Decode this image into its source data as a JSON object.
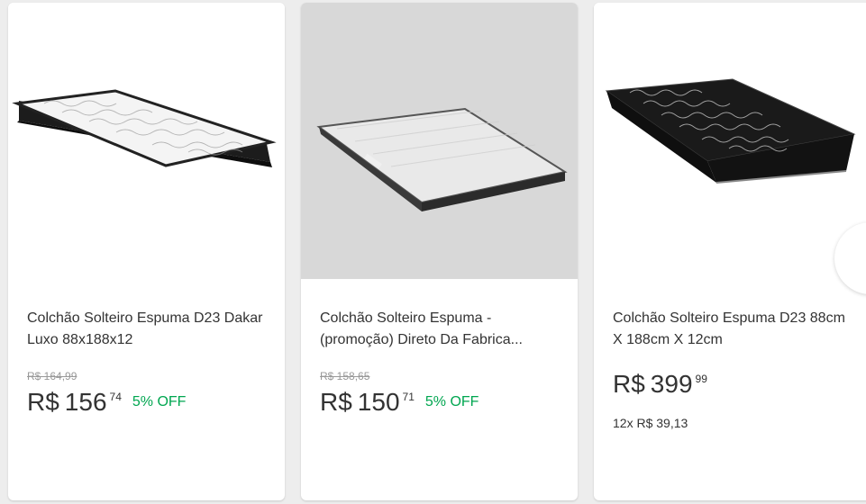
{
  "products": [
    {
      "title": "Colchão Solteiro Espuma D23 Dakar Luxo 88x188x12",
      "old_price": "R$ 164,99",
      "currency": "R$",
      "price_int": "156",
      "price_cents": "74",
      "discount": "5% OFF"
    },
    {
      "title": "Colchão Solteiro Espuma - (promoção) Direto Da Fabrica...",
      "old_price": "R$ 158,65",
      "currency": "R$",
      "price_int": "150",
      "price_cents": "71",
      "discount": "5% OFF"
    },
    {
      "title": "Colchão Solteiro Espuma D23 88cm X 188cm X 12cm",
      "currency": "R$",
      "price_int": "399",
      "price_cents": "99",
      "installments": "12x R$ 39,13"
    }
  ],
  "colors": {
    "discount": "#00a650",
    "text": "#333333",
    "muted": "#999999",
    "background": "#ededed"
  }
}
